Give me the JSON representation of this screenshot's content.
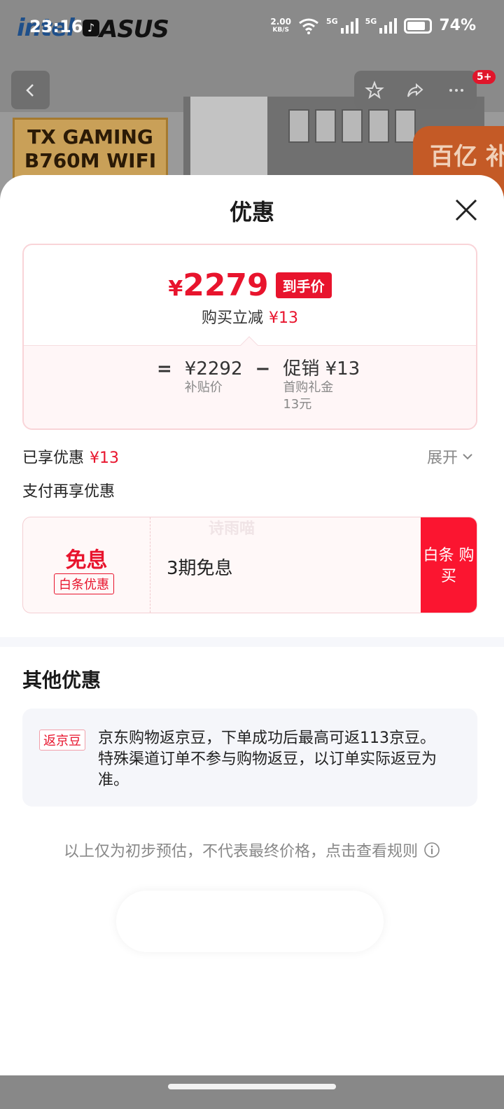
{
  "status_bar": {
    "time": "23:16",
    "speed_value": "2.00",
    "speed_unit": "KB/S",
    "net1": "5G",
    "net2": "5G",
    "battery": "74%"
  },
  "background": {
    "brand_intel": "intel",
    "brand_asus": "ASUS",
    "box_label": "TX GAMING B760M WIFI",
    "subsidy_badge": "百亿 补贴",
    "cart_badge": "5+"
  },
  "sheet": {
    "title": "优惠",
    "price": {
      "final_price": "2279",
      "currency": "¥",
      "final_tag": "到手价",
      "reduce_label": "购买立减",
      "reduce_amount": "¥13",
      "eq": "=",
      "minus": "−",
      "subsidy_price": "¥2292",
      "subsidy_label": "补贴价",
      "promo_value": "促销 ¥13",
      "promo_sub1": "首购礼金",
      "promo_sub2": "13元"
    },
    "enjoyed_label": "已享优惠",
    "enjoyed_amount": "¥13",
    "expand_label": "展开",
    "pay_title": "支付再享优惠",
    "pay_card": {
      "big": "免息",
      "tag": "白条优惠",
      "desc": "3期免息",
      "button": "白条 购买",
      "watermark": "诗雨喵"
    },
    "other_title": "其他优惠",
    "bean": {
      "tag": "返京豆",
      "text": "京东购物返京豆，下单成功后最高可返113京豆。特殊渠道订单不参与购物返豆，以订单实际返豆为准。"
    },
    "disclaimer": "以上仅为初步预估，不代表最终价格，点击查看规则"
  },
  "colors": {
    "accent_red": "#e8142d",
    "button_red": "#fb1530"
  }
}
